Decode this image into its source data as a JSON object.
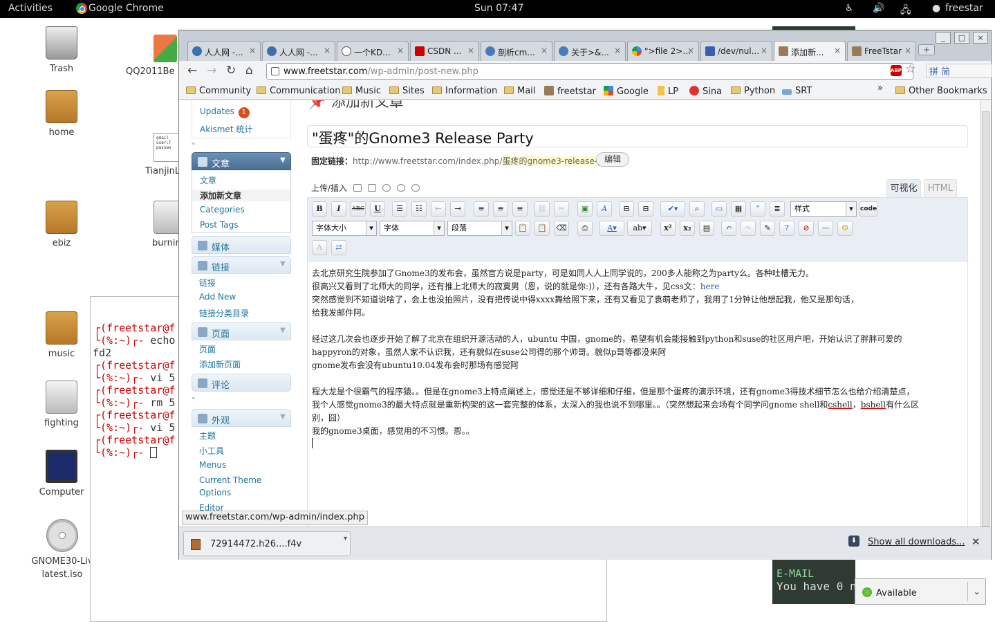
{
  "topbar": {
    "activities": "Activities",
    "app_name": "Google Chrome",
    "clock": "Sun 07:47",
    "user": "freestar"
  },
  "desktop": {
    "icons": [
      {
        "label": "Trash"
      },
      {
        "label": "QQ2011Be"
      },
      {
        "label": "home"
      },
      {
        "label": "TianjinL"
      },
      {
        "label": "ebiz"
      },
      {
        "label": "burnin"
      },
      {
        "label": "music"
      },
      {
        "label": "fighting"
      },
      {
        "label": "Computer"
      },
      {
        "label": "GNOME30-Liv"
      },
      {
        "label": "latest.iso"
      }
    ],
    "doc_preview": [
      "gmail",
      "user:T",
      "passwo"
    ]
  },
  "terminal": {
    "lines": [
      {
        "a": "┌(",
        "b": "freetstar@f"
      },
      {
        "a": "└(%:~)┌- ",
        "b": "echo"
      },
      {
        "a": "",
        "b": "fd2"
      },
      {
        "a": "┌(",
        "b": "freetstar@f"
      },
      {
        "a": "└(%:~)┌- ",
        "b": "vi 5"
      },
      {
        "a": "┌(",
        "b": "freetstar@f"
      },
      {
        "a": "└(%:~)┌- ",
        "b": "rm 5"
      },
      {
        "a": "┌(",
        "b": "freetstar@f"
      },
      {
        "a": "└(%:~)┌- ",
        "b": "vi 5"
      },
      {
        "a": "┌(",
        "b": "freetstar@f"
      },
      {
        "a": "└(%:~)┌- ",
        "b": ""
      }
    ]
  },
  "background_terminal": {
    "email_label": "E-MAIL",
    "you_have": "You have 0 n"
  },
  "pidgin": {
    "status": "Available"
  },
  "chrome": {
    "window_controls": [
      "_",
      "□",
      "×"
    ],
    "tabs": [
      {
        "title": "人人网 -..."
      },
      {
        "title": "人人网 -..."
      },
      {
        "title": "一个KD..."
      },
      {
        "title": "CSDN ..."
      },
      {
        "title": "剖析cm..."
      },
      {
        "title": "关于>&..."
      },
      {
        "title": "\">file 2>..."
      },
      {
        "title": "/dev/nul..."
      },
      {
        "title": "添加新..."
      },
      {
        "title": "FreeTstar"
      }
    ],
    "url_host": "www.freetstar.com",
    "url_path": "/wp-admin/post-new.php",
    "ime_text": "拼 简",
    "bookmarks": [
      {
        "label": "Community"
      },
      {
        "label": "Communication"
      },
      {
        "label": "Music"
      },
      {
        "label": "Sites"
      },
      {
        "label": "Information"
      },
      {
        "label": "Mail"
      },
      {
        "label": "freetstar"
      },
      {
        "label": "Google"
      },
      {
        "label": "LP"
      },
      {
        "label": "Sina"
      },
      {
        "label": "Python"
      },
      {
        "label": "SRT"
      }
    ],
    "bookmarks_more": "»",
    "other_bookmarks": "Other Bookmarks",
    "status_url": "www.freetstar.com/wp-admin/index.php",
    "download": {
      "filename": "72914472.h26....f4v"
    },
    "show_all_downloads": "Show all downloads..."
  },
  "wp_nav": {
    "dashboard": {
      "updates": "Updates",
      "updates_count": "1",
      "akismet": "Akismet 统计"
    },
    "posts": {
      "head": "文章",
      "items": [
        "文章",
        "添加新文章",
        "Categories",
        "Post Tags"
      ]
    },
    "media": {
      "head": "媒体"
    },
    "links": {
      "head": "链接",
      "items": [
        "链接",
        "Add New",
        "链接分类目录"
      ]
    },
    "pages": {
      "head": "页面",
      "items": [
        "页面",
        "添加新页面"
      ]
    },
    "comments": {
      "head": "评论"
    },
    "appearance": {
      "head": "外观",
      "items": [
        "主题",
        "小工具",
        "Menus",
        "Current Theme",
        "Options",
        "Editor"
      ]
    }
  },
  "editor": {
    "page_heading": "添加新文章",
    "post_title": "\"蛋疼\"的Gnome3 Release Party",
    "permalink_label": "固定链接：",
    "permalink_base": "http://www.freetstar.com/index.php/",
    "permalink_slug": "蛋疼的gnome3-release-party",
    "edit_button": "编辑",
    "upload_insert": "上传/插入",
    "mode_visual": "可视化",
    "mode_html": "HTML",
    "toolbar": {
      "bold": "B",
      "italic": "I",
      "strike": "ABC",
      "underline": "U",
      "style_select": "样式",
      "code": "code",
      "fontsize_select": "字体大小",
      "font_select": "字体",
      "paragraph_select": "段落",
      "sup": "x²",
      "sub": "x₂"
    },
    "body": {
      "p1": "去北京研究生院参加了Gnome3的发布会，虽然官方说是party，可是如同人人上同学说的，200多人能称之为party么。各种吐槽无力。",
      "p2": "很高兴又看到了北师大的‍同学，还有推上北师大的寂寞男（恩，说的就是你:)），还有各路大牛，见css文：",
      "p2_link": "here",
      "p3": "突然感觉到不知道说啥了，会上也没拍照片，没有把传说中得xxxx舞给照下来，还有又看见了袁萌老师了，我用了1分钟让他想起我，他又是那句话，",
      "p4": "给我发邮件阿。",
      "p5": "经过这几次会也逐步开始了解了北京在组织开源活动的人，ubuntu 中国，gnome的，希望有机会能接触到python和suse的社区用户吧，开始认识了胖胖可爱的",
      "p6": "happyron的对象，虽然人家不认识我，还有貌似在suse公司得的那个帅哥。貌似p哥等都没来阿",
      "p7": "gnome发布会没有ubuntu10.04发布会时那场有感觉阿",
      "p8": "程大龙是个很霸气的程序猿。。但是在gnome3上特点阐述上，感觉还是不够详细和仔细，但是那个蛋疼的演示环境，还有gnome3得技术细节怎么也给介绍清楚点，",
      "p9a": "我个人感觉gnome3的最大特点就是重新构架的这一套完整的体系，太深入的我也说不到哪里。。（突然想起来会场有个同学问gnome shell和",
      "p9b": "cshell",
      "p9c": "，",
      "p9d": "bshell",
      "p9e": "有什么区",
      "p10": "别，囧）",
      "p11": "我的gnome3桌面，感觉用的不习惯。恩。。"
    }
  },
  "colors": {
    "wp_link": "#21759b",
    "wp_menu_active": "#4a6f96",
    "badge": "#d54e21",
    "terminal_prompt": "#cc0000",
    "pidgin_available": "#3a3"
  }
}
